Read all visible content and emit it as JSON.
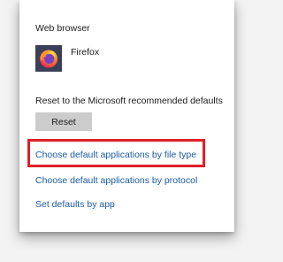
{
  "section": {
    "title": "Web browser"
  },
  "default_app": {
    "name": "Firefox",
    "icon": "firefox-icon"
  },
  "reset": {
    "label": "Reset to the Microsoft recommended defaults",
    "button_label": "Reset"
  },
  "links": {
    "by_file_type": "Choose default applications by file type",
    "by_protocol": "Choose default applications by protocol",
    "by_app": "Set defaults by app"
  },
  "colors": {
    "link": "#1a5aa8",
    "highlight": "#e0202a",
    "button_bg": "#cccccc"
  }
}
